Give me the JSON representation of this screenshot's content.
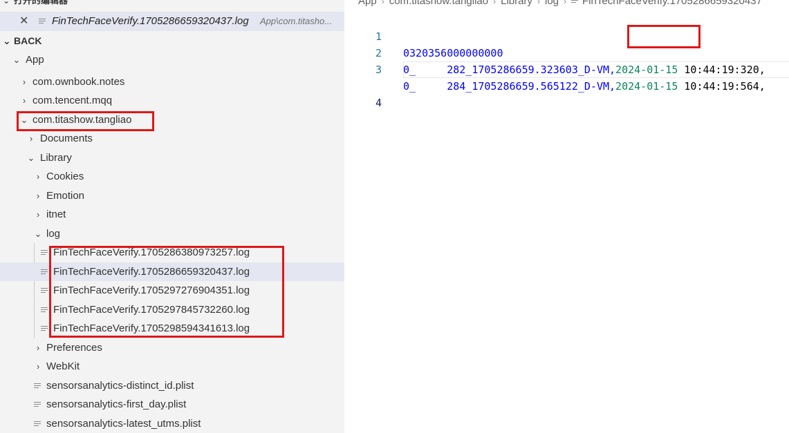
{
  "open_editors": {
    "header": "打开的编辑器",
    "file_name": "FinTechFaceVerify.1705286659320437.log",
    "file_path": "App\\com.titasho..."
  },
  "explorer": {
    "section": "BACK",
    "root": "App",
    "items": [
      {
        "label": "com.ownbook.notes"
      },
      {
        "label": "com.tencent.mqq"
      },
      {
        "label": "com.titashow.tangliao"
      },
      {
        "label": "Documents"
      },
      {
        "label": "Library"
      },
      {
        "label": "Cookies"
      },
      {
        "label": "Emotion"
      },
      {
        "label": "itnet"
      },
      {
        "label": "log"
      },
      {
        "label": "FinTechFaceVerify.1705286380973257.log"
      },
      {
        "label": "FinTechFaceVerify.1705286659320437.log"
      },
      {
        "label": "FinTechFaceVerify.1705297276904351.log"
      },
      {
        "label": "FinTechFaceVerify.1705297845732260.log"
      },
      {
        "label": "FinTechFaceVerify.1705298594341613.log"
      },
      {
        "label": "Preferences"
      },
      {
        "label": "WebKit"
      },
      {
        "label": "sensorsanalytics-distinct_id.plist"
      },
      {
        "label": "sensorsanalytics-first_day.plist"
      },
      {
        "label": "sensorsanalytics-latest_utms.plist"
      }
    ]
  },
  "breadcrumb": [
    "App",
    "com.titashow.tangliao",
    "Library",
    "log",
    "FinTechFaceVerify.1705286659320437"
  ],
  "editor": {
    "lines": [
      {
        "num": "1",
        "text": "0320356000000000"
      },
      {
        "num": "2",
        "prefix": "0_     282_1705286659.323603_D-VM,",
        "date": "2024-01-15",
        "time": " 10:44:19:320,"
      },
      {
        "num": "3",
        "prefix": "0_     284_1705286659.565122_D-VM,",
        "date": "2024-01-15",
        "time": " 10:44:19:564,"
      },
      {
        "num": "4",
        "text": ""
      }
    ]
  },
  "icons": {
    "chevron_right": "›",
    "chevron_down": "⌄",
    "close": "✕"
  },
  "colors": {
    "highlight_box": "#e01717",
    "selection": "#e4e6f1"
  }
}
